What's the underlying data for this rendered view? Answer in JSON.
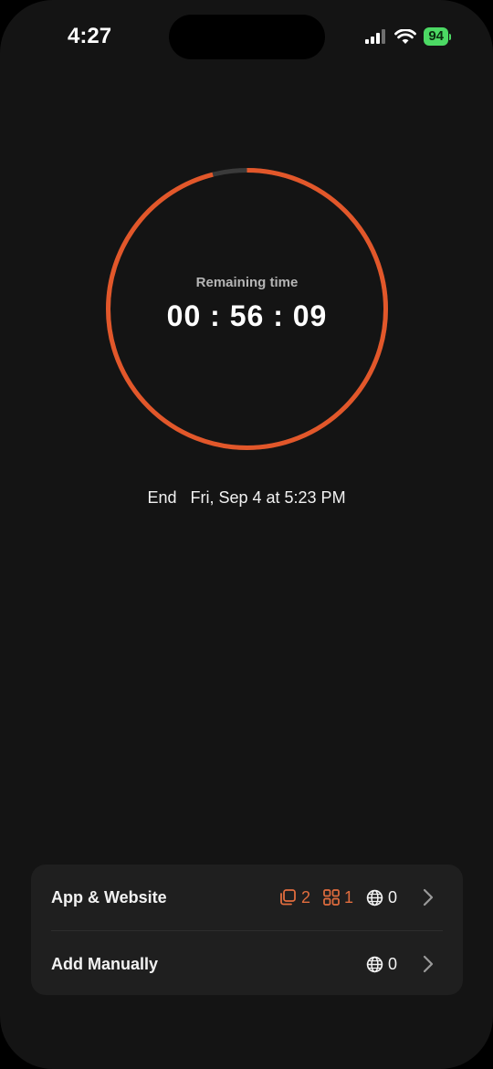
{
  "status_bar": {
    "time": "4:27",
    "battery": "94"
  },
  "timer": {
    "label": "Remaining time",
    "remaining": "00 : 56 : 09",
    "progress": 0.96
  },
  "end": {
    "label": "End",
    "value": "Fri, Sep 4 at 5:23 PM"
  },
  "list": [
    {
      "label": "App & Website",
      "categories": "2",
      "apps": "1",
      "websites": "0"
    },
    {
      "label": "Add Manually",
      "websites": "0"
    }
  ],
  "colors": {
    "accent": "#e2572a",
    "track": "#3a3a3a",
    "background": "#141414",
    "card": "#1f1f1f"
  },
  "icons": [
    "signal-icon",
    "wifi-icon",
    "battery-charging-icon",
    "category-stack-icon",
    "app-grid-icon",
    "globe-icon",
    "chevron-right-icon"
  ]
}
